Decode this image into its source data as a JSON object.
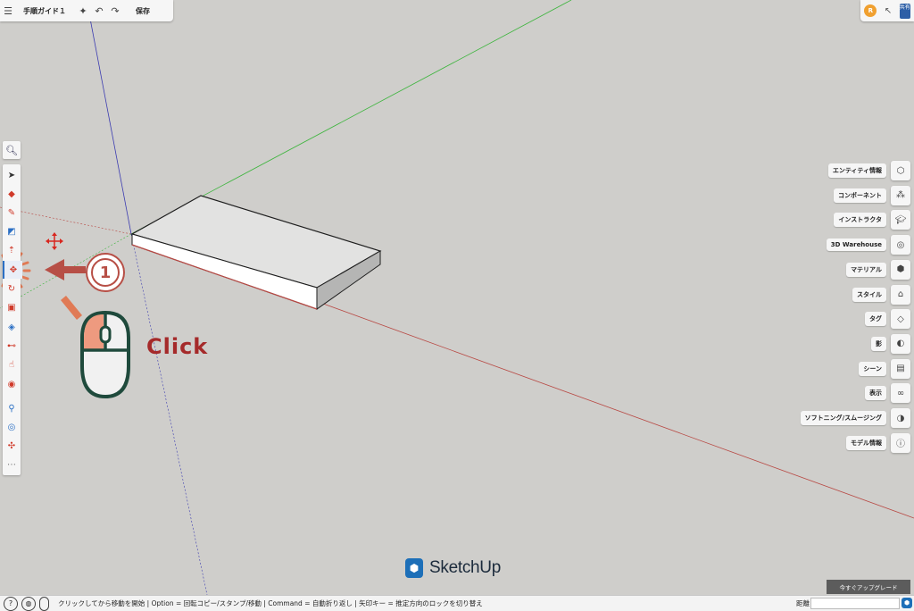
{
  "topbar": {
    "title": "手順ガイド１",
    "save_label": "保存",
    "menu_icon": "hamburger-icon",
    "ai_icon": "sparkle-icon",
    "undo_icon": "undo-icon",
    "redo_icon": "redo-icon"
  },
  "topright": {
    "avatar_letter": "R",
    "share_label": "共有"
  },
  "right_panel": {
    "items": [
      {
        "label": "エンティティ情報",
        "icon": "cube-icon"
      },
      {
        "label": "コンポーネント",
        "icon": "components-icon"
      },
      {
        "label": "インストラクタ",
        "icon": "graduation-cap-icon"
      },
      {
        "label": "3D Warehouse",
        "icon": "warehouse-icon"
      },
      {
        "label": "マテリアル",
        "icon": "material-icon"
      },
      {
        "label": "スタイル",
        "icon": "style-icon"
      },
      {
        "label": "タグ",
        "icon": "tag-icon"
      },
      {
        "label": "影",
        "icon": "shadow-icon"
      },
      {
        "label": "シーン",
        "icon": "scenes-icon"
      },
      {
        "label": "表示",
        "icon": "glasses-icon"
      },
      {
        "label": "ソフトニング/スムージング",
        "icon": "soften-icon"
      },
      {
        "label": "モデル情報",
        "icon": "info-icon"
      }
    ]
  },
  "tutorial": {
    "step_number": "1",
    "click_label": "Click"
  },
  "logo": {
    "name": "SketchUp"
  },
  "upgrade_label": "今すぐアップグレード",
  "statusbar": {
    "text": "クリックしてから移動を開始 | Option = 回転コピー/スタンプ/移動 | Command = 自動折り返し | 矢印キー = 推定方向のロックを切り替え",
    "distance_label": "距離",
    "distance_value": ""
  },
  "colors": {
    "canvas": "#cfcecb",
    "accent": "#b74f46",
    "brand": "#1d6fb8",
    "axis_red": "#b84a45",
    "axis_green": "#3fb53f",
    "axis_blue": "#3c3cb0"
  }
}
